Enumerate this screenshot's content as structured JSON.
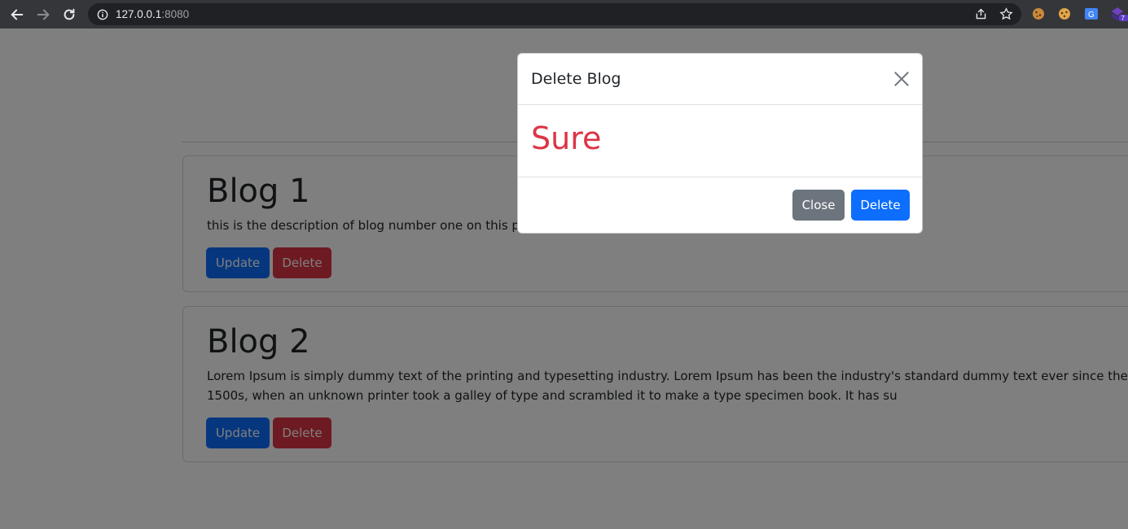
{
  "browser": {
    "url_host": "127.0.0.1",
    "url_port": ":8080",
    "extension_badge": "7"
  },
  "blogs": [
    {
      "title": "Blog 1",
      "description": "this is the description of blog number one on this platform",
      "update_label": "Update",
      "delete_label": "Delete"
    },
    {
      "title": "Blog 2",
      "description": "Lorem Ipsum is simply dummy text of the printing and typesetting industry. Lorem Ipsum has been the industry's standard dummy text ever since the 1500s, when an unknown printer took a galley of type and scrambled it to make a type specimen book. It has su",
      "update_label": "Update",
      "delete_label": "Delete"
    }
  ],
  "modal": {
    "title": "Delete Blog",
    "body": "Sure",
    "close_label": "Close",
    "delete_label": "Delete"
  },
  "colors": {
    "primary": "#0d6efd",
    "danger": "#dc3545",
    "secondary": "#6c757d"
  }
}
